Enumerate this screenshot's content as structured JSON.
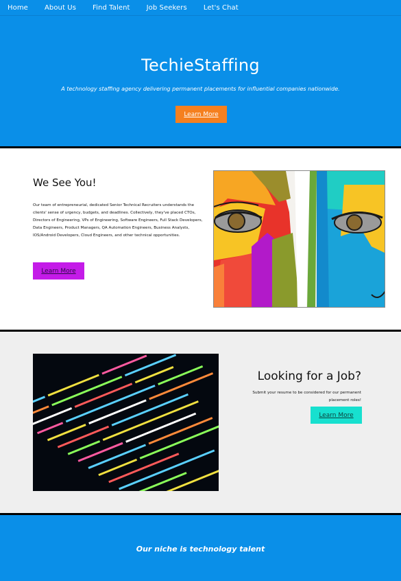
{
  "nav": {
    "items": [
      {
        "label": "Home"
      },
      {
        "label": "About Us"
      },
      {
        "label": "Find Talent"
      },
      {
        "label": "Job Seekers"
      },
      {
        "label": "Let's Chat"
      }
    ]
  },
  "hero": {
    "title": "TechieStaffing",
    "subtitle": "A technology staffing agency delivering permanent placements for influential companies nationwide.",
    "button_label": "Learn More"
  },
  "section1": {
    "title": "We See You!",
    "body": "Our team of entrepreneurial, dedicated Senior Technical Recruiters understands the clients' sense of urgency, budgets, and deadlines. Collectively, they've placed CTOs, Directors of Engineering, VPs of Engineering, Software Engineers, Full Stack Developers, Data Engineers, Product Managers, QA Automation Engineers, Business Analysts, IOS/Android Developers, Cloud Engineers, and other technical opportunities.",
    "button_label": "Learn More"
  },
  "section2": {
    "title": "Looking for a Job?",
    "body": "Submit your resume to be considered for our permanent placement roles!",
    "button_label": "Learn More"
  },
  "footer": {
    "tagline": "Our niche is technology talent"
  },
  "colors": {
    "brand_blue": "#0a8fe8",
    "orange_button": "#f5801f",
    "purple_button": "#c41be8",
    "teal_button": "#17e0cf"
  }
}
